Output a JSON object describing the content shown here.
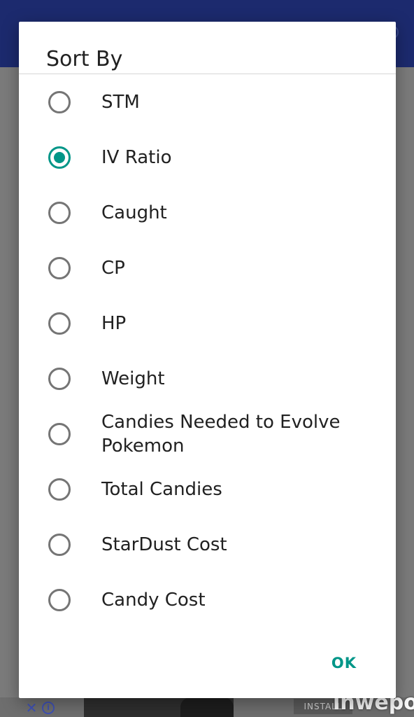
{
  "dialog": {
    "title": "Sort By",
    "options": [
      {
        "label": "STM",
        "checked": false
      },
      {
        "label": "IV Ratio",
        "checked": true
      },
      {
        "label": "Caught",
        "checked": false
      },
      {
        "label": "CP",
        "checked": false
      },
      {
        "label": "HP",
        "checked": false
      },
      {
        "label": "Weight",
        "checked": false
      },
      {
        "label": "Candies Needed to Evolve Pokemon",
        "checked": false
      },
      {
        "label": "Total Candies",
        "checked": false
      },
      {
        "label": "StarDust Cost",
        "checked": false
      },
      {
        "label": "Candy Cost",
        "checked": false
      }
    ],
    "ok_label": "OK"
  },
  "ad": {
    "close_icon": "close-icon",
    "info_icon": "info-icon",
    "install_label": "INSTALL"
  },
  "watermark": {
    "text": "inwepo"
  },
  "colors": {
    "accent": "#009688",
    "appbar": "#1c2a6e",
    "scrim": "#7a7a7a"
  }
}
